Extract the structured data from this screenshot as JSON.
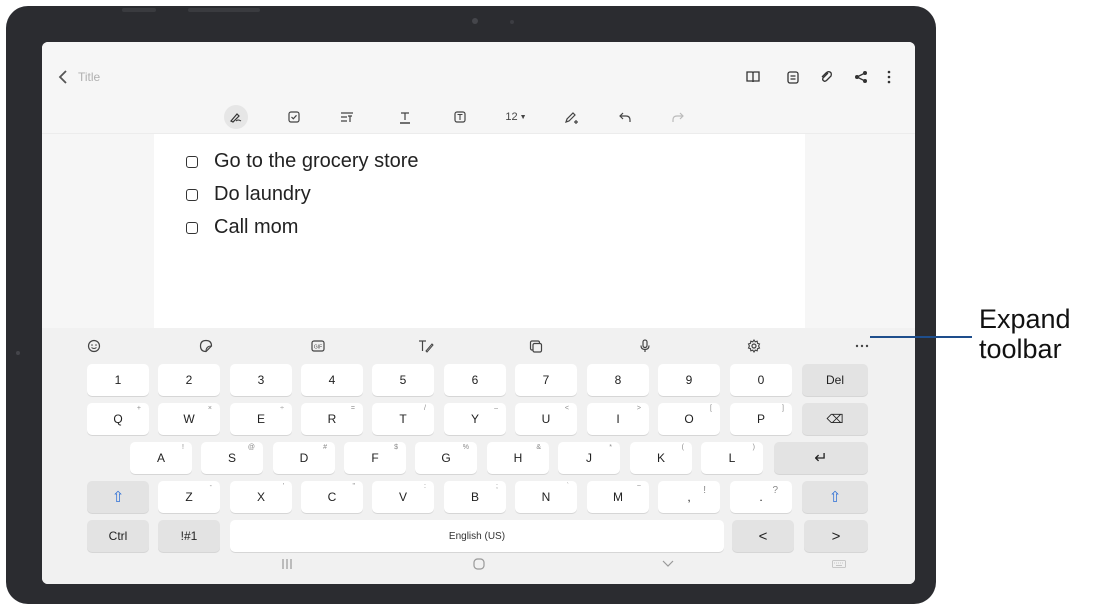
{
  "header": {
    "back_icon": "chevron-left-icon",
    "title": "Title",
    "icons": [
      "book-icon",
      "document-icon",
      "attachment-icon",
      "share-icon",
      "more-vertical-icon"
    ]
  },
  "format_bar": {
    "icons": [
      "pen-icon",
      "checkbox-icon",
      "text-style-icon",
      "text-color-icon",
      "text-box-icon",
      "font-size",
      "highlighter-icon",
      "undo-icon",
      "redo-icon"
    ],
    "font_size": "12"
  },
  "note": {
    "items": [
      {
        "text": "Go to the grocery store",
        "checked": false
      },
      {
        "text": "Do laundry",
        "checked": false
      },
      {
        "text": "Call mom",
        "checked": false
      }
    ]
  },
  "keyboard": {
    "toolbar": [
      "emoji-icon",
      "sticker-icon",
      "gif-icon",
      "handwriting-icon",
      "clipboard-icon",
      "microphone-icon",
      "settings-icon",
      "expand-toolbar-icon"
    ],
    "rows": [
      [
        {
          "label": "1"
        },
        {
          "label": "2"
        },
        {
          "label": "3"
        },
        {
          "label": "4"
        },
        {
          "label": "5"
        },
        {
          "label": "6"
        },
        {
          "label": "7"
        },
        {
          "label": "8"
        },
        {
          "label": "9"
        },
        {
          "label": "0"
        },
        {
          "label": "Del"
        }
      ],
      [
        {
          "label": "Q",
          "sub": "+"
        },
        {
          "label": "W",
          "sub": "×"
        },
        {
          "label": "E",
          "sub": "÷"
        },
        {
          "label": "R",
          "sub": "="
        },
        {
          "label": "T",
          "sub": "/"
        },
        {
          "label": "Y",
          "sub": "–"
        },
        {
          "label": "U",
          "sub": "<"
        },
        {
          "label": "I",
          "sub": ">"
        },
        {
          "label": "O",
          "sub": "["
        },
        {
          "label": "P",
          "sub": "]"
        },
        {
          "label": "⌫"
        }
      ],
      [
        {
          "label": "A",
          "sub": "!"
        },
        {
          "label": "S",
          "sub": "@"
        },
        {
          "label": "D",
          "sub": "#"
        },
        {
          "label": "F",
          "sub": "$"
        },
        {
          "label": "G",
          "sub": "%"
        },
        {
          "label": "H",
          "sub": "&"
        },
        {
          "label": "J",
          "sub": "*"
        },
        {
          "label": "K",
          "sub": "("
        },
        {
          "label": "L",
          "sub": ")"
        },
        {
          "label": "↵"
        }
      ],
      [
        {
          "label": "⇧"
        },
        {
          "label": "Z",
          "sub": "-"
        },
        {
          "label": "X",
          "sub": "'"
        },
        {
          "label": "C",
          "sub": "\""
        },
        {
          "label": "V",
          "sub": ":"
        },
        {
          "label": "B",
          "sub": ";"
        },
        {
          "label": "N",
          "sub": "`"
        },
        {
          "label": "M",
          "sub": "~"
        },
        {
          "label": ",",
          "sub": "!"
        },
        {
          "label": ".",
          "sub": "?"
        },
        {
          "label": "⇧"
        }
      ],
      [
        {
          "label": "Ctrl"
        },
        {
          "label": "!#1"
        },
        {
          "label": "English (US)"
        },
        {
          "label": "<"
        },
        {
          "label": ">"
        }
      ]
    ]
  },
  "nav_bar": {
    "icons": [
      "recent-apps-icon",
      "home-icon",
      "hide-keyboard-icon",
      "keyboard-icon"
    ]
  },
  "annotation": {
    "line1": "Expand",
    "line2": "toolbar"
  }
}
